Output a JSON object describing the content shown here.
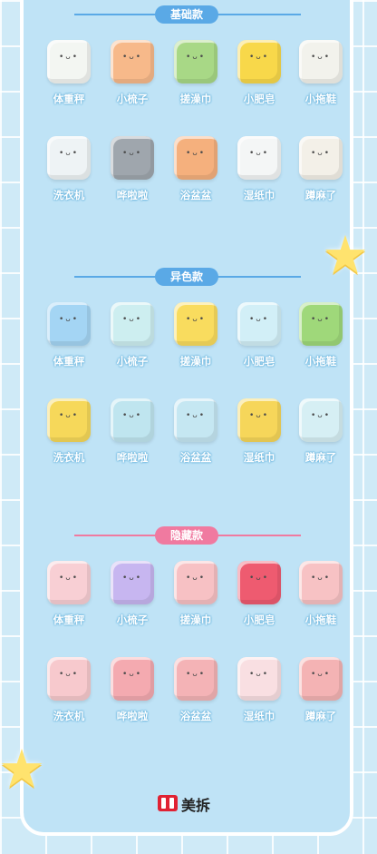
{
  "sections": [
    {
      "title": "基础款",
      "accent": "#5aa9e6",
      "row1": [
        {
          "label": "体重秤",
          "color": "#f3f6f2"
        },
        {
          "label": "小梳子",
          "color": "#f7b98a"
        },
        {
          "label": "搓澡巾",
          "color": "#a8d886"
        },
        {
          "label": "小肥皂",
          "color": "#f8d84a"
        },
        {
          "label": "小拖鞋",
          "color": "#f2f2ec"
        }
      ],
      "row2": [
        {
          "label": "洗衣机",
          "color": "#eef3f5"
        },
        {
          "label": "哗啦啦",
          "color": "#9fa6ad"
        },
        {
          "label": "浴盆盆",
          "color": "#f5b07d"
        },
        {
          "label": "湿纸巾",
          "color": "#f4f6f6"
        },
        {
          "label": "蹲麻了",
          "color": "#f3f0e8"
        }
      ]
    },
    {
      "title": "异色款",
      "accent": "#5aa9e6",
      "row1": [
        {
          "label": "体重秤",
          "color": "#a4d5f4"
        },
        {
          "label": "小梳子",
          "color": "#cdeef0"
        },
        {
          "label": "搓澡巾",
          "color": "#f9dc5e"
        },
        {
          "label": "小肥皂",
          "color": "#d2eff7"
        },
        {
          "label": "小拖鞋",
          "color": "#9fd87a"
        }
      ],
      "row2": [
        {
          "label": "洗衣机",
          "color": "#f6d85a"
        },
        {
          "label": "哗啦啦",
          "color": "#bfe5ef"
        },
        {
          "label": "浴盆盆",
          "color": "#c5e7f2"
        },
        {
          "label": "湿纸巾",
          "color": "#f6d65a"
        },
        {
          "label": "蹲麻了",
          "color": "#d6eff4"
        }
      ]
    },
    {
      "title": "隐藏款",
      "accent": "#f07aa0",
      "row1": [
        {
          "label": "体重秤",
          "color": "#f8cfd4"
        },
        {
          "label": "小梳子",
          "color": "#c7b6f0"
        },
        {
          "label": "搓澡巾",
          "color": "#f7c1c4"
        },
        {
          "label": "小肥皂",
          "color": "#ee5b70"
        },
        {
          "label": "小拖鞋",
          "color": "#f7c2c4"
        }
      ],
      "row2": [
        {
          "label": "洗衣机",
          "color": "#f7c9cd"
        },
        {
          "label": "哗啦啦",
          "color": "#f4aab0"
        },
        {
          "label": "浴盆盆",
          "color": "#f4b3b6"
        },
        {
          "label": "湿纸巾",
          "color": "#f9dfe2"
        },
        {
          "label": "蹲麻了",
          "color": "#f4b3b4"
        }
      ]
    }
  ],
  "brand": {
    "name": "美拆",
    "logo_color": "#e02233"
  },
  "decor": {
    "star_color": "#ffe36e"
  }
}
